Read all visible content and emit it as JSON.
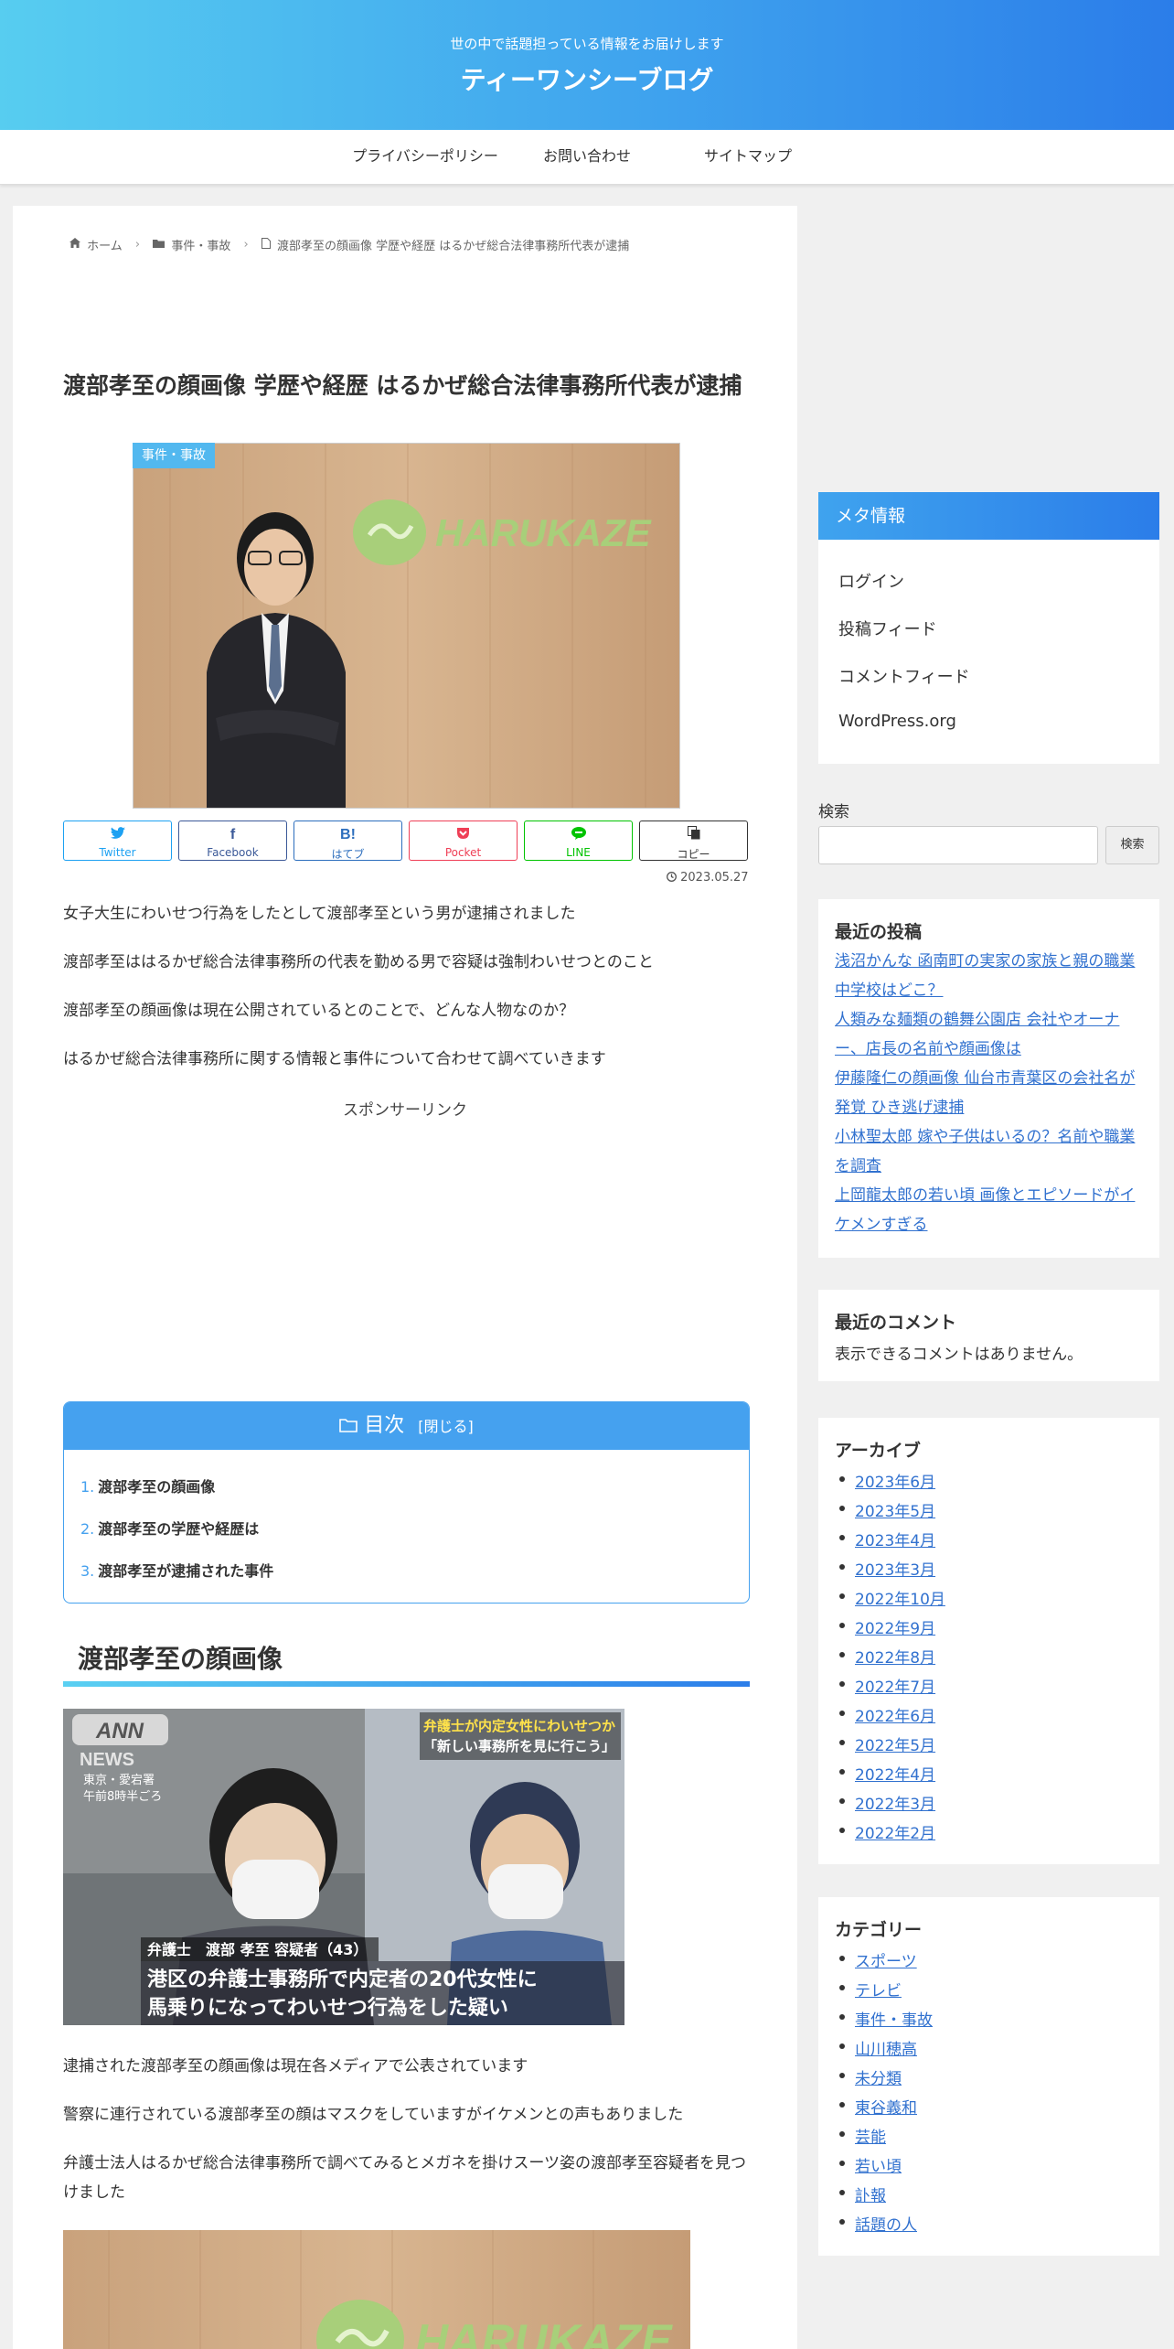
{
  "site": {
    "tagline": "世の中で話題担っている情報をお届けします",
    "title": "ティーワンシーブログ"
  },
  "nav": [
    "プライバシーポリシー",
    "お問い合わせ",
    "サイトマップ"
  ],
  "breadcrumb": {
    "home": "ホーム",
    "category": "事件・事故",
    "current": "渡部孝至の顔画像 学歴や経歴 はるかぜ総合法律事務所代表が逮捕"
  },
  "post": {
    "title": "渡部孝至の顔画像 学歴や経歴 はるかぜ総合法律事務所代表が逮捕",
    "category_label": "事件・事故",
    "date": "2023.05.27",
    "intro": [
      "女子大生にわいせつ行為をしたとして渡部孝至という男が逮捕されました",
      "渡部孝至ははるかぜ総合法律事務所の代表を勤める男で容疑は強制わいせつとのこと",
      "渡部孝至の顔画像は現在公開されているとのことで、どんな人物なのか？",
      "はるかぜ総合法律事務所に関する情報と事件について合わせて調べていきます"
    ],
    "sponsor": "スポンサーリンク",
    "section_heading": "渡部孝至の顔画像",
    "section_paras": [
      "逮捕された渡部孝至の顔画像は現在各メディアで公表されています",
      "警察に連行されている渡部孝至の顔はマスクをしていますがイケメンとの声もありました",
      "弁護士法人はるかぜ総合法律事務所で調べてみるとメガネを掛けスーツ姿の渡部孝至容疑者を見つけました"
    ],
    "logo_text": "HARUKAZE",
    "news_overlay": {
      "ann": "ANN",
      "news": "NEWS",
      "place": "東京・愛宕署",
      "time": "午前8時半ごろ",
      "top_caption_1": "弁護士が内定女性にわいせつか",
      "top_caption_2": "「新しい事務所を見に行こう」",
      "name_caption": "弁護士　渡部 孝至 容疑者（43）",
      "main_caption_1": "港区の弁護士事務所で内定者の20代女性に",
      "main_caption_2": "馬乗りになってわいせつ行為をした疑い"
    }
  },
  "share": [
    {
      "label": "Twitter",
      "icon": "twitter-icon",
      "glyph": "🐦",
      "color": "#1da1f2"
    },
    {
      "label": "Facebook",
      "icon": "facebook-icon",
      "glyph": "f",
      "color": "#3b5998"
    },
    {
      "label": "はてブ",
      "icon": "hatena-icon",
      "glyph": "B!",
      "color": "#2c6ebd"
    },
    {
      "label": "Pocket",
      "icon": "pocket-icon",
      "glyph": "◆",
      "color": "#ef3f56"
    },
    {
      "label": "LINE",
      "icon": "line-icon",
      "glyph": "●",
      "color": "#00c300"
    },
    {
      "label": "コピー",
      "icon": "copy-icon",
      "glyph": "▤",
      "color": "#333333"
    }
  ],
  "toc": {
    "title": "目次",
    "toggle": "[閉じる]",
    "items": [
      {
        "num": "1.",
        "label": "渡部孝至の顔画像"
      },
      {
        "num": "2.",
        "label": "渡部孝至の学歴や経歴は"
      },
      {
        "num": "3.",
        "label": "渡部孝至が逮捕された事件"
      }
    ]
  },
  "sidebar": {
    "meta": {
      "title": "メタ情報",
      "items": [
        "ログイン",
        "投稿フィード",
        "コメントフィード",
        "WordPress.org"
      ]
    },
    "search": {
      "label": "検索",
      "button": "検索"
    },
    "recent_posts": {
      "title": "最近の投稿",
      "items": [
        "浅沼かんな 函南町の実家の家族と親の職業 中学校はどこ？",
        "人類みな麺類の鶴舞公園店 会社やオーナー、店長の名前や顔画像は",
        "伊藤隆仁の顔画像 仙台市青葉区の会社名が発覚 ひき逃げ逮捕",
        "小林聖太郎 嫁や子供はいるの？名前や職業を調査",
        "上岡龍太郎の若い頃 画像とエピソードがイケメンすぎる"
      ]
    },
    "recent_comments": {
      "title": "最近のコメント",
      "empty": "表示できるコメントはありません。"
    },
    "archives": {
      "title": "アーカイブ",
      "items": [
        "2023年6月",
        "2023年5月",
        "2023年4月",
        "2023年3月",
        "2022年10月",
        "2022年9月",
        "2022年8月",
        "2022年7月",
        "2022年6月",
        "2022年5月",
        "2022年4月",
        "2022年3月",
        "2022年2月"
      ]
    },
    "categories": {
      "title": "カテゴリー",
      "items": [
        "スポーツ",
        "テレビ",
        "事件・事故",
        "山川穂高",
        "未分類",
        "東谷義和",
        "芸能",
        "若い頃",
        "訃報",
        "話題の人"
      ]
    }
  }
}
